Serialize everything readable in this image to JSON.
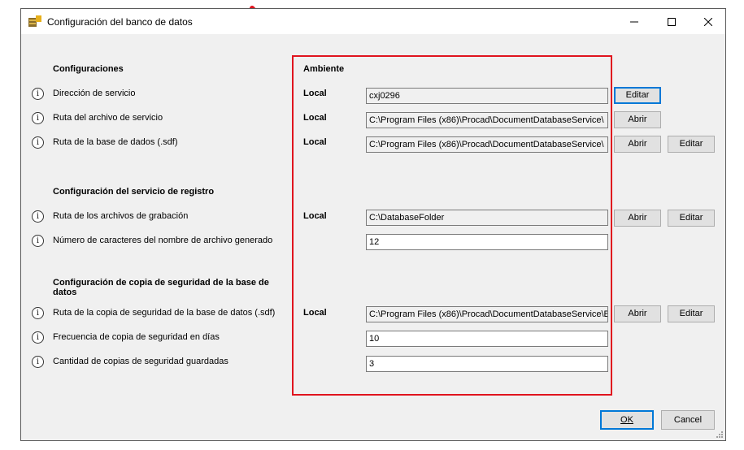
{
  "window": {
    "title": "Configuración del banco de datos"
  },
  "headers": {
    "configuraciones": "Configuraciones",
    "ambiente": "Ambiente",
    "servicio_registro": "Configuración del servicio de registro",
    "copia_seguridad_l1": "Configuración de copia de seguridad de la base de",
    "copia_seguridad_l2": "datos"
  },
  "rows": [
    {
      "label": "Dirección de servicio",
      "env": "Local",
      "value": "cxj0296",
      "btn1": "Editar"
    },
    {
      "label": "Ruta del archivo de servicio",
      "env": "Local",
      "value": "C:\\Program Files (x86)\\Procad\\DocumentDatabaseService\\",
      "btn1": "Abrir"
    },
    {
      "label": "Ruta de la base de dados (.sdf)",
      "env": "Local",
      "value": "C:\\Program Files (x86)\\Procad\\DocumentDatabaseService\\",
      "btn1": "Abrir",
      "btn2": "Editar"
    },
    {
      "label": "Ruta de los archivos de grabación",
      "env": "Local",
      "value": "C:\\DatabaseFolder",
      "btn1": "Abrir",
      "btn2": "Editar"
    },
    {
      "label": "Número de caracteres del nombre de archivo generado",
      "value": "12"
    },
    {
      "label": "Ruta de la copia de seguridad de la base de datos (.sdf)",
      "env": "Local",
      "value": "C:\\Program Files (x86)\\Procad\\DocumentDatabaseService\\B",
      "btn1": "Abrir",
      "btn2": "Editar"
    },
    {
      "label": "Frecuencia de copia de seguridad en días",
      "value": "10"
    },
    {
      "label": "Cantidad de copias de seguridad guardadas",
      "value": "3"
    }
  ],
  "footer": {
    "ok": "OK",
    "cancel": "Cancel"
  },
  "info_glyph": "i",
  "colors": {
    "highlight_box": "#e0141e",
    "focus_border": "#0078d7"
  }
}
